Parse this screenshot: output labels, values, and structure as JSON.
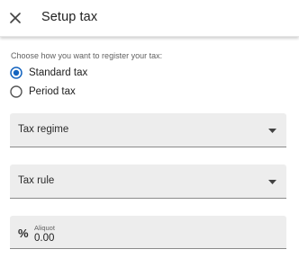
{
  "header": {
    "title": "Setup tax",
    "close_icon": "close-icon"
  },
  "registration": {
    "prompt": "Choose how you want to register your tax:",
    "options": [
      {
        "label": "Standard tax",
        "selected": true
      },
      {
        "label": "Period tax",
        "selected": false
      }
    ]
  },
  "fields": {
    "tax_regime": {
      "label": "Tax regime",
      "icon": "dropdown-arrow-icon"
    },
    "tax_rule": {
      "label": "Tax rule",
      "icon": "dropdown-arrow-icon"
    },
    "aliquot": {
      "label": "Aliquot",
      "value": "0.00",
      "icon": "percent-icon",
      "icon_glyph": "%"
    }
  },
  "colors": {
    "accent": "#1565c0",
    "field_background": "#ededed",
    "field_underline": "#8a8a8a"
  }
}
